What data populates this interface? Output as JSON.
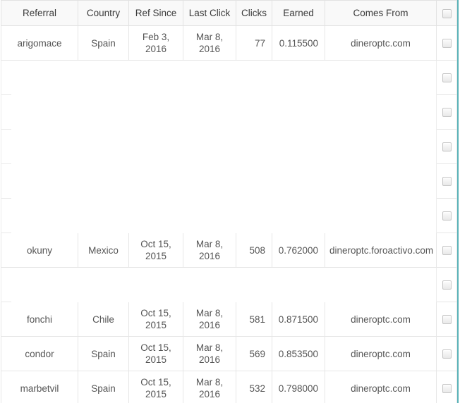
{
  "table": {
    "columns": [
      {
        "key": "referral",
        "label": "Referral",
        "align": "center"
      },
      {
        "key": "country",
        "label": "Country",
        "align": "center"
      },
      {
        "key": "ref_since",
        "label": "Ref Since",
        "align": "center"
      },
      {
        "key": "last_click",
        "label": "Last Click",
        "align": "center"
      },
      {
        "key": "clicks",
        "label": "Clicks",
        "align": "right"
      },
      {
        "key": "earned",
        "label": "Earned",
        "align": "right"
      },
      {
        "key": "comes_from",
        "label": "Comes From",
        "align": "center"
      }
    ],
    "select_all": {
      "name": "select-all-checkbox",
      "checked": false
    },
    "rows": [
      {
        "referral": "arigomace",
        "country": "Spain",
        "ref_since_1": "Feb 3,",
        "ref_since_2": "2016",
        "last_click_1": "Mar 8,",
        "last_click_2": "2016",
        "clicks": "77",
        "earned": "0.115500",
        "comes_from": "dineroptc.com",
        "blank": false,
        "checked": false
      },
      {
        "blank": true,
        "checked": false
      },
      {
        "blank": true,
        "checked": false
      },
      {
        "blank": true,
        "checked": false
      },
      {
        "blank": true,
        "checked": false
      },
      {
        "blank": true,
        "checked": false
      },
      {
        "referral": "okuny",
        "country": "Mexico",
        "ref_since_1": "Oct 15,",
        "ref_since_2": "2015",
        "last_click_1": "Mar 8,",
        "last_click_2": "2016",
        "clicks": "508",
        "earned": "0.762000",
        "comes_from": "dineroptc.foroactivo.com",
        "blank": false,
        "checked": false
      },
      {
        "blank": true,
        "checked": false
      },
      {
        "referral": "fonchi",
        "country": "Chile",
        "ref_since_1": "Oct 15,",
        "ref_since_2": "2015",
        "last_click_1": "Mar 8,",
        "last_click_2": "2016",
        "clicks": "581",
        "earned": "0.871500",
        "comes_from": "dineroptc.com",
        "blank": false,
        "checked": false
      },
      {
        "referral": "condor",
        "country": "Spain",
        "ref_since_1": "Oct 15,",
        "ref_since_2": "2015",
        "last_click_1": "Mar 8,",
        "last_click_2": "2016",
        "clicks": "569",
        "earned": "0.853500",
        "comes_from": "dineroptc.com",
        "blank": false,
        "checked": false
      },
      {
        "referral": "marbetvil",
        "country": "Spain",
        "ref_since_1": "Oct 15,",
        "ref_since_2": "2015",
        "last_click_1": "Mar 8,",
        "last_click_2": "2016",
        "clicks": "532",
        "earned": "0.798000",
        "comes_from": "dineroptc.com",
        "blank": false,
        "checked": false
      }
    ]
  },
  "colors": {
    "header_bg": "#f9f9f9",
    "border": "#e6e6e6",
    "text": "#555555",
    "header_text": "#3a3a3a",
    "rail": "#5bb3b8"
  }
}
